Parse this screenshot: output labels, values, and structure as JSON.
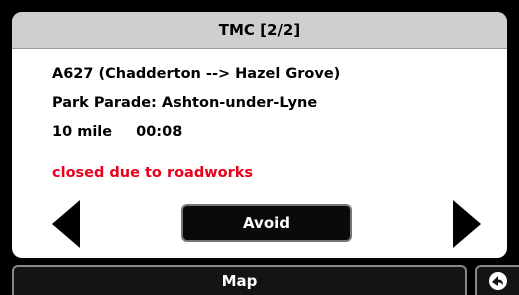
{
  "dialog": {
    "title": "TMC [2/2]",
    "road": "A627 (Chadderton --> Hazel Grove)",
    "location": "Park Parade: Ashton-under-Lyne",
    "distance": "10 mile",
    "time": "00:08",
    "status": "closed due to roadworks",
    "status_color": "#e8001c",
    "avoid_label": "Avoid",
    "prev_icon": "arrow-left-icon",
    "next_icon": "arrow-right-icon"
  },
  "bottom": {
    "map_label": "Map",
    "corner_icon": "return-arrow-icon"
  }
}
